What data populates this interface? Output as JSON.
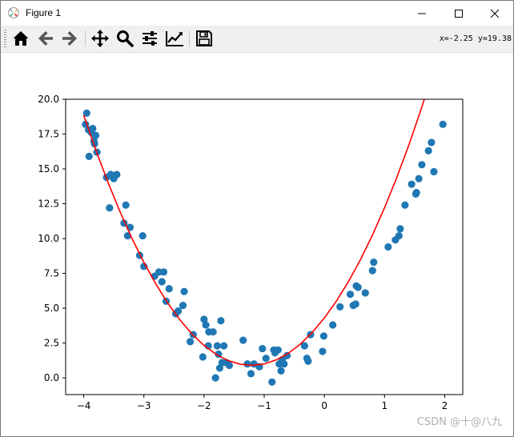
{
  "window": {
    "title": "Figure 1",
    "controls": {
      "minimize": "minimize",
      "maximize": "maximize",
      "close": "close"
    }
  },
  "toolbar": {
    "buttons": [
      {
        "name": "home",
        "icon": "home-icon"
      },
      {
        "name": "back",
        "icon": "arrow-left-icon"
      },
      {
        "name": "forward",
        "icon": "arrow-right-icon"
      },
      {
        "name": "pan",
        "icon": "move-icon"
      },
      {
        "name": "zoom",
        "icon": "magnifier-icon"
      },
      {
        "name": "configure-subplots",
        "icon": "sliders-icon"
      },
      {
        "name": "edit-axis",
        "icon": "line-chart-icon"
      },
      {
        "name": "save",
        "icon": "floppy-disk-icon"
      }
    ],
    "coords": "x=-2.25 y=19.38"
  },
  "watermark": "CSDN @十@八九",
  "colors": {
    "scatter": "#1f77b4",
    "fit_line": "#ff0000"
  },
  "chart_data": {
    "type": "scatter",
    "title": "",
    "xlabel": "",
    "ylabel": "",
    "xlim": [
      -4.3,
      2.3
    ],
    "ylim": [
      -1.2,
      20.0
    ],
    "xticks": [
      -4,
      -3,
      -2,
      -1,
      0,
      1,
      2
    ],
    "xtick_labels": [
      "−4",
      "−3",
      "−2",
      "−1",
      "0",
      "1",
      "2"
    ],
    "yticks": [
      0.0,
      2.5,
      5.0,
      7.5,
      10.0,
      12.5,
      15.0,
      17.5,
      20.0
    ],
    "ytick_labels": [
      "0.0",
      "2.5",
      "5.0",
      "7.5",
      "10.0",
      "12.5",
      "15.0",
      "17.5",
      "20.0"
    ],
    "grid": false,
    "legend": "none",
    "series": [
      {
        "kind": "scatter",
        "x": [
          -3.97,
          -3.95,
          -3.92,
          -3.91,
          -3.87,
          -3.85,
          -3.83,
          -3.82,
          -3.8,
          -3.78,
          -3.62,
          -3.57,
          -3.55,
          -3.5,
          -3.45,
          -3.33,
          -3.3,
          -3.27,
          -3.23,
          -3.07,
          -3.02,
          -3.0,
          -2.82,
          -2.75,
          -2.7,
          -2.67,
          -2.63,
          -2.58,
          -2.47,
          -2.43,
          -2.35,
          -2.33,
          -2.23,
          -2.18,
          -2.02,
          -2.0,
          -1.97,
          -1.93,
          -1.92,
          -1.85,
          -1.81,
          -1.78,
          -1.76,
          -1.74,
          -1.72,
          -1.7,
          -1.67,
          -1.63,
          -1.58,
          -1.35,
          -1.28,
          -1.22,
          -1.17,
          -1.08,
          -1.03,
          -0.97,
          -0.87,
          -0.84,
          -0.82,
          -0.77,
          -0.75,
          -0.72,
          -0.7,
          -0.67,
          -0.62,
          -0.33,
          -0.29,
          -0.27,
          -0.23,
          -0.03,
          -0.01,
          0.14,
          0.26,
          0.43,
          0.48,
          0.52,
          0.53,
          0.56,
          0.68,
          0.8,
          0.82,
          1.06,
          1.18,
          1.24,
          1.26,
          1.34,
          1.45,
          1.52,
          1.53,
          1.57,
          1.62,
          1.73,
          1.78,
          1.82,
          1.97
        ],
        "y": [
          18.2,
          19.0,
          17.8,
          15.9,
          17.6,
          17.9,
          17.0,
          16.8,
          17.4,
          16.2,
          14.4,
          12.2,
          14.6,
          14.3,
          14.6,
          11.1,
          12.4,
          10.2,
          10.8,
          8.8,
          10.2,
          8.0,
          7.3,
          7.6,
          6.9,
          7.6,
          5.5,
          6.4,
          4.6,
          4.8,
          5.2,
          6.2,
          2.6,
          3.1,
          1.5,
          4.2,
          3.8,
          2.3,
          3.3,
          3.3,
          0.0,
          2.3,
          1.7,
          0.7,
          4.1,
          1.1,
          2.3,
          1.1,
          0.9,
          2.7,
          1.0,
          0.3,
          1.0,
          0.8,
          2.1,
          1.4,
          -0.3,
          2.0,
          1.8,
          2.0,
          1.0,
          0.5,
          1.3,
          1.0,
          1.6,
          2.3,
          1.4,
          1.2,
          3.1,
          1.9,
          3.0,
          3.8,
          5.1,
          6.0,
          5.2,
          5.3,
          6.6,
          6.5,
          6.1,
          7.7,
          8.3,
          9.4,
          9.9,
          10.2,
          10.7,
          12.4,
          13.9,
          13.2,
          13.3,
          14.3,
          15.3,
          16.3,
          16.9,
          14.8,
          18.2
        ]
      },
      {
        "kind": "line",
        "x": [
          -4.0,
          -3.8,
          -3.6,
          -3.4,
          -3.2,
          -3.0,
          -2.8,
          -2.6,
          -2.4,
          -2.2,
          -2.0,
          -1.8,
          -1.6,
          -1.4,
          -1.2,
          -1.0,
          -0.8,
          -0.6,
          -0.4,
          -0.2,
          0.0,
          0.2,
          0.4,
          0.6,
          0.8,
          1.0,
          1.2,
          1.4,
          1.6,
          1.8,
          2.0
        ],
        "y": [
          18.85,
          16.37,
          14.08,
          11.96,
          10.03,
          8.29,
          6.73,
          5.35,
          4.16,
          3.15,
          2.33,
          1.69,
          1.24,
          0.98,
          0.9,
          1.0,
          1.29,
          1.76,
          2.42,
          3.27,
          4.3,
          5.51,
          6.91,
          8.49,
          10.26,
          12.21,
          14.35,
          16.67,
          19.18,
          21.87,
          24.75
        ]
      }
    ]
  }
}
